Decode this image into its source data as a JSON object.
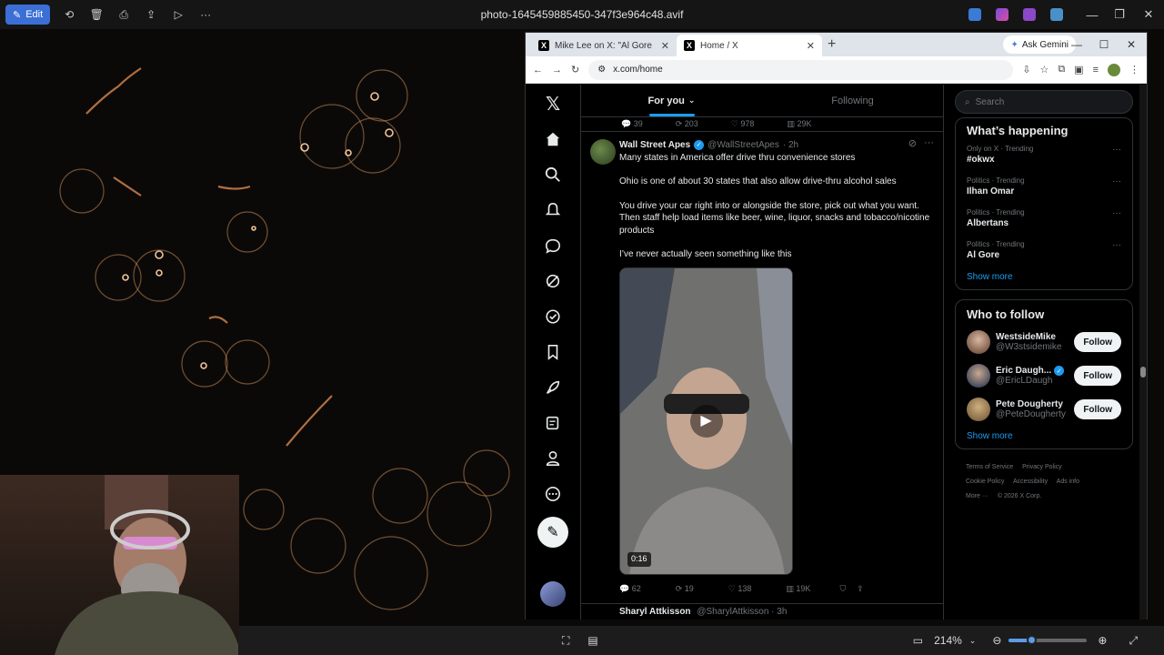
{
  "photos_app": {
    "edit_label": "Edit",
    "file_title": "photo-1645459885450-347f3e964c48.avif",
    "zoom_level": "214%"
  },
  "browser": {
    "tabs": [
      {
        "label": "Mike Lee on X: \"Al Gore has cal",
        "active": false
      },
      {
        "label": "Home / X",
        "active": true
      }
    ],
    "ask_gemini": "Ask Gemini",
    "url": "x.com/home"
  },
  "feed": {
    "tabs": [
      {
        "label": "For you",
        "active": true
      },
      {
        "label": "Following",
        "active": false
      }
    ],
    "prev_actions": {
      "replies": "39",
      "reposts": "203",
      "likes": "978",
      "views": "29K"
    },
    "tweet": {
      "author_name": "Wall Street Apes",
      "handle": "@WallStreetApes",
      "time": "· 2h",
      "paragraphs": [
        "Many states in America offer drive thru convenience stores",
        "Ohio is one of about 30 states that also allow drive-thru alcohol sales",
        "You drive your car right into or alongside the store, pick out what you want. Then staff help load items like beer, wine, liquor, snacks and tobacco/nicotine products",
        "I’ve never actually seen something like this"
      ],
      "video_duration": "0:16",
      "replies": "62",
      "reposts": "19",
      "likes": "138",
      "views": "19K"
    },
    "next_tweet_author": "Sharyl Attkisson",
    "next_tweet_meta": "@SharylAttkisson · 3h"
  },
  "sidebar": {
    "search_placeholder": "Search",
    "happening_title": "What’s happening",
    "trends": [
      {
        "context": "Only on X · Trending",
        "name": "#okwx"
      },
      {
        "context": "Politics · Trending",
        "name": "Ilhan Omar"
      },
      {
        "context": "Politics · Trending",
        "name": "Albertans"
      },
      {
        "context": "Politics · Trending",
        "name": "Al Gore"
      }
    ],
    "show_more": "Show more",
    "who_to_follow_title": "Who to follow",
    "follow_suggestions": [
      {
        "name": "WestsideMike",
        "handle": "@W3stsidemike",
        "verified": false,
        "button": "Follow"
      },
      {
        "name": "Eric Daugh...",
        "handle": "@EricLDaugh",
        "verified": true,
        "button": "Follow"
      },
      {
        "name": "Pete Dougherty",
        "handle": "@PeteDougherty",
        "verified": false,
        "button": "Follow"
      }
    ],
    "footer_links": [
      "Terms of Service",
      "Privacy Policy",
      "Cookie Policy",
      "Accessibility",
      "Ads info",
      "More ···",
      "© 2026 X Corp."
    ]
  },
  "colors": {
    "x_blue": "#1d9bf0",
    "photos_accent": "#3b6fd6"
  }
}
